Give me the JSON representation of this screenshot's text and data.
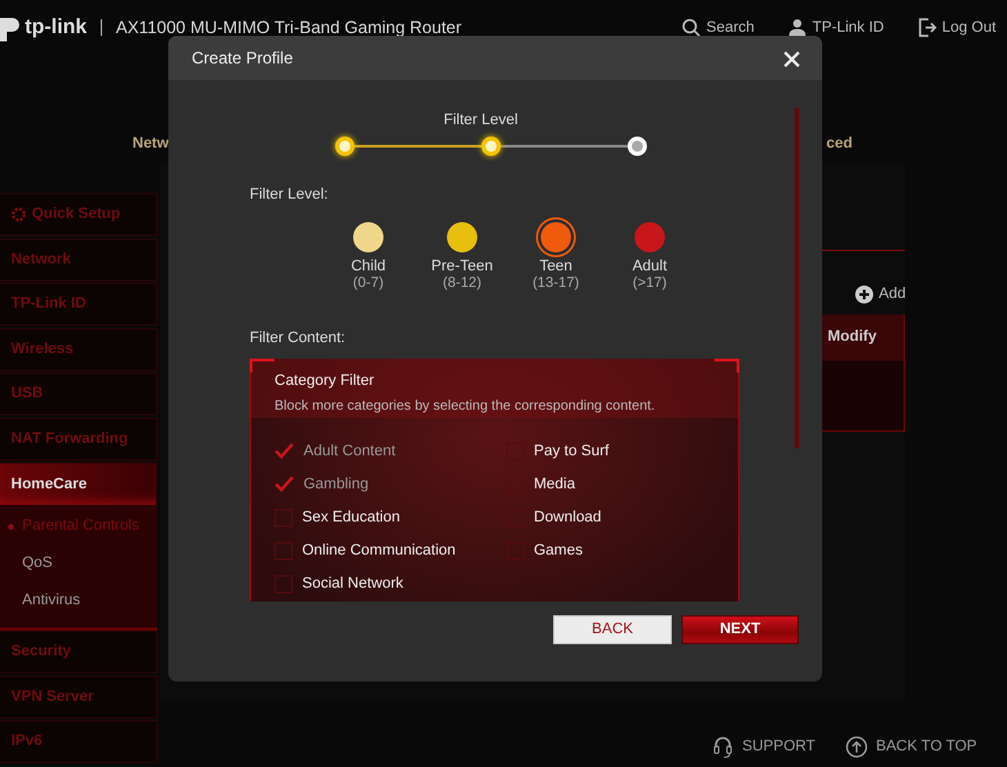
{
  "header": {
    "logo": "tp-link",
    "title": "AX11000 MU-MIMO Tri-Band Gaming Router",
    "links": [
      {
        "kind": "search",
        "label": "Search"
      },
      {
        "kind": "account",
        "label": "TP-Link ID"
      },
      {
        "kind": "logout",
        "label": "Log Out"
      }
    ]
  },
  "top_nav": [
    {
      "label": "Netw"
    },
    {
      "label": "ced"
    }
  ],
  "sidebar": {
    "items": [
      {
        "kind": "setup",
        "label": "Quick Setup",
        "selected": false
      },
      {
        "label": "Network",
        "selected": false
      },
      {
        "label": "TP-Link ID",
        "selected": false
      },
      {
        "label": "Wireless",
        "selected": false
      },
      {
        "label": "USB",
        "selected": false
      },
      {
        "label": "NAT Forwarding",
        "selected": false
      },
      {
        "label": "HomeCare",
        "selected": true,
        "expanded": true,
        "children": [
          {
            "label": "Parental Controls",
            "selected": true
          },
          {
            "label": "QoS",
            "selected": false
          },
          {
            "label": "Antivirus",
            "selected": false
          }
        ]
      },
      {
        "label": "Security",
        "selected": false
      },
      {
        "label": "VPN Server",
        "selected": false
      },
      {
        "label": "IPv6",
        "selected": false
      }
    ]
  },
  "content": {
    "add_label": "Add",
    "table_header": "Modify"
  },
  "dialog": {
    "title": "Create Profile",
    "stepper": {
      "title": "Filter Level",
      "steps": [
        {
          "done": true
        },
        {
          "done": true
        },
        {
          "done": false
        }
      ]
    },
    "filter_level": {
      "label": "Filter Level:",
      "options": [
        {
          "name": "Child",
          "range": "(0-7)",
          "color": "#f0d68a",
          "selected": false
        },
        {
          "name": "Pre-Teen",
          "range": "(8-12)",
          "color": "#e9bf0e",
          "selected": false
        },
        {
          "name": "Teen",
          "range": "(13-17)",
          "color": "#f05a0c",
          "selected": true
        },
        {
          "name": "Adult",
          "range": "(>17)",
          "color": "#c8161a",
          "selected": false
        }
      ]
    },
    "filter_content": {
      "label": "Filter Content:",
      "panel": {
        "title": "Category Filter",
        "description": "Block more categories by selecting the corresponding content.",
        "categories": [
          {
            "label": "Adult Content",
            "checked": true
          },
          {
            "label": "Pay to Surf",
            "checked": false
          },
          {
            "label": "Gambling",
            "checked": true
          },
          {
            "label": "Media",
            "checked": false
          },
          {
            "label": "Sex Education",
            "checked": false
          },
          {
            "label": "Download",
            "checked": false
          },
          {
            "label": "Online Communication",
            "checked": false
          },
          {
            "label": "Games",
            "checked": false
          },
          {
            "label": "Social Network",
            "checked": false
          }
        ]
      }
    },
    "buttons": [
      {
        "kind": "secondary",
        "label": "BACK"
      },
      {
        "kind": "primary",
        "label": "NEXT"
      }
    ]
  },
  "footer": {
    "links": [
      {
        "kind": "support",
        "label": "SUPPORT"
      },
      {
        "kind": "top",
        "label": "BACK TO TOP"
      }
    ]
  }
}
